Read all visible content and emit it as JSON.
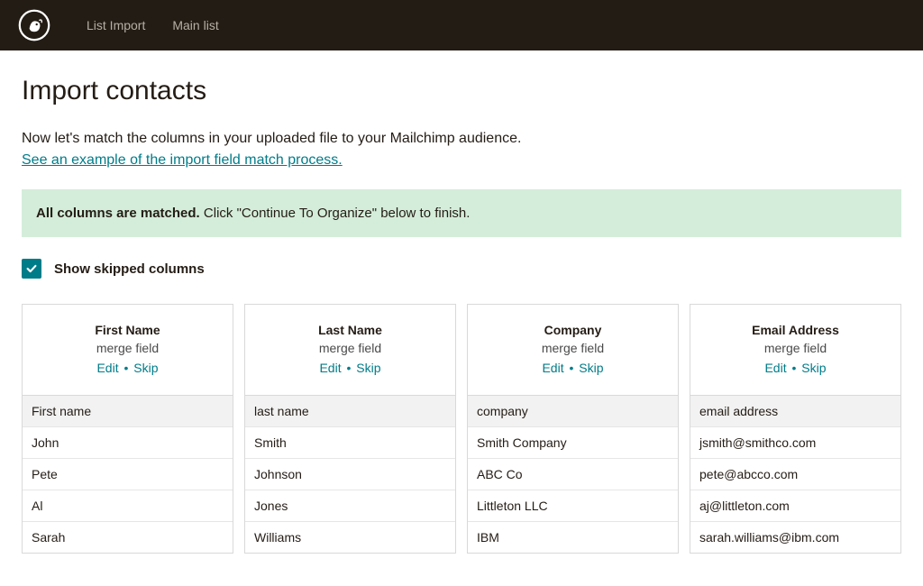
{
  "nav": {
    "items": [
      {
        "label": "List Import"
      },
      {
        "label": "Main list"
      }
    ]
  },
  "page": {
    "title": "Import contacts",
    "subtitle": "Now let's match the columns in your uploaded file to your Mailchimp audience.",
    "example_link": "See an example of the import field match process."
  },
  "banner": {
    "bold": "All columns are matched.",
    "rest": " Click \"Continue To Organize\" below to finish."
  },
  "checkbox": {
    "label": "Show skipped columns",
    "checked": true
  },
  "columns": [
    {
      "title": "First Name",
      "subtitle": "merge field",
      "edit": "Edit",
      "skip": "Skip",
      "header": "First name",
      "rows": [
        "John",
        "Pete",
        "Al",
        "Sarah"
      ]
    },
    {
      "title": "Last Name",
      "subtitle": "merge field",
      "edit": "Edit",
      "skip": "Skip",
      "header": "last name",
      "rows": [
        "Smith",
        "Johnson",
        "Jones",
        "Williams"
      ]
    },
    {
      "title": "Company",
      "subtitle": "merge field",
      "edit": "Edit",
      "skip": "Skip",
      "header": "company",
      "rows": [
        "Smith Company",
        "ABC Co",
        "Littleton LLC",
        "IBM"
      ]
    },
    {
      "title": "Email Address",
      "subtitle": "merge field",
      "edit": "Edit",
      "skip": "Skip",
      "header": "email address",
      "rows": [
        "jsmith@smithco.com",
        "pete@abcco.com",
        "aj@littleton.com",
        "sarah.williams@ibm.com"
      ]
    }
  ]
}
